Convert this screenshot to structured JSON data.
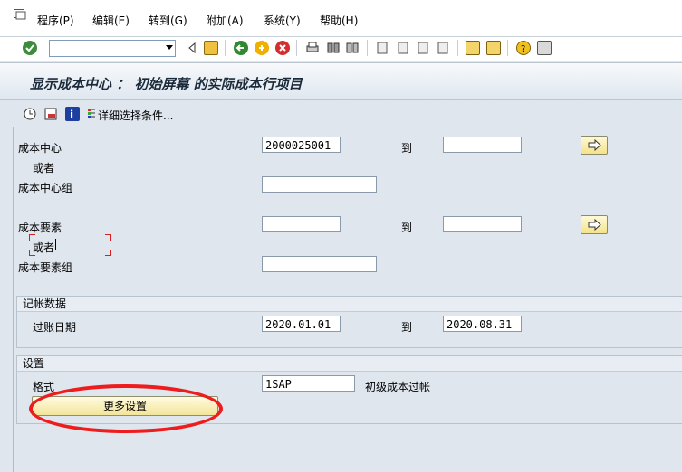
{
  "menu": {
    "items": [
      "程序(P)",
      "编辑(E)",
      "转到(G)",
      "附加(A)",
      "系统(Y)",
      "帮助(H)"
    ]
  },
  "toolbar": {
    "command_value": "",
    "icons": [
      "check-icon",
      "back-icon",
      "save-icon",
      "back-arrow-icon",
      "exit-icon",
      "cancel-icon",
      "print-icon",
      "find-icon",
      "find-next-icon",
      "first-page-icon",
      "prev-page-icon",
      "next-page-icon",
      "last-page-icon",
      "new-session-icon",
      "shortcut-icon",
      "help-icon",
      "layout-icon"
    ]
  },
  "title": "显示成本中心 ： 初始屏幕 的实际成本行项目",
  "app_toolbar": {
    "more_criteria": "详细选择条件..."
  },
  "form": {
    "cost_center_label": "成本中心",
    "cost_center_from": "2000025001",
    "to_label": "到",
    "cost_center_to": "",
    "or_label": "或者",
    "cost_center_group_label": "成本中心组",
    "cost_center_group_value": "",
    "cost_element_label": "成本要素",
    "cost_element_from": "",
    "cost_element_to": "",
    "or_label_2": "或者",
    "cost_element_group_label": "成本要素组",
    "cost_element_group_value": ""
  },
  "posting": {
    "group_title": "记帐数据",
    "posting_date_label": "过账日期",
    "date_from": "2020.01.01",
    "to_label": "到",
    "date_to": "2020.08.31"
  },
  "settings": {
    "group_title": "设置",
    "layout_label": "格式",
    "layout_value": "1SAP",
    "layout_desc": "初级成本过帐",
    "more_settings": "更多设置"
  },
  "colors": {
    "highlight": "#ee1c1c",
    "background": "#dfe6ee"
  }
}
